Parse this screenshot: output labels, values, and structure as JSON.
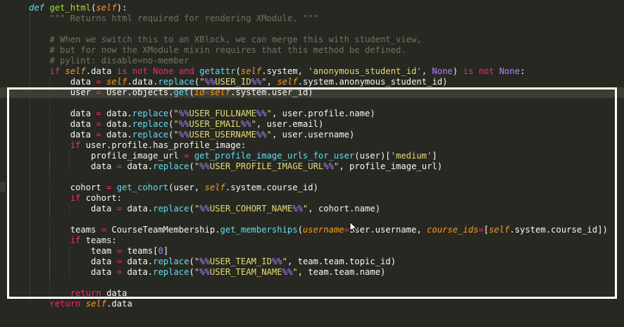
{
  "editor": {
    "theme_colors": {
      "background": "#272822",
      "default": "#f8f8f2",
      "keyword": "#f92672",
      "def": "#66d9ef",
      "function": "#a6e22e",
      "string": "#e6db74",
      "comment": "#75715e",
      "self": "#fd971f",
      "number": "#ae81ff",
      "format": "#ae81ff",
      "param": "#fd971f"
    },
    "lines": [
      {
        "tokens": [
          {
            "t": "def ",
            "c": "def",
            "i": true
          },
          {
            "t": "get_html",
            "c": "function"
          },
          {
            "t": "(",
            "c": "default"
          },
          {
            "t": "self",
            "c": "self",
            "i": true
          },
          {
            "t": "):",
            "c": "default"
          }
        ]
      },
      {
        "tokens": [
          {
            "t": "    ",
            "c": "default"
          },
          {
            "t": "\"\"\" Returns html required for rendering XModule. \"\"\"",
            "c": "comment"
          }
        ]
      },
      {
        "tokens": [
          {
            "t": "",
            "c": "default"
          }
        ]
      },
      {
        "tokens": [
          {
            "t": "    ",
            "c": "default"
          },
          {
            "t": "# When we switch this to an XBlock, we can merge this with student_view,",
            "c": "comment"
          }
        ]
      },
      {
        "tokens": [
          {
            "t": "    ",
            "c": "default"
          },
          {
            "t": "# but for now the XModule mixin requires that this method be defined.",
            "c": "comment"
          }
        ]
      },
      {
        "tokens": [
          {
            "t": "    ",
            "c": "default"
          },
          {
            "t": "# pylint: disable=no-member",
            "c": "comment"
          }
        ]
      },
      {
        "tokens": [
          {
            "t": "    ",
            "c": "default"
          },
          {
            "t": "if ",
            "c": "keyword"
          },
          {
            "t": "self",
            "c": "self",
            "i": true
          },
          {
            "t": ".data ",
            "c": "default"
          },
          {
            "t": "is not None and ",
            "c": "keyword"
          },
          {
            "t": "getattr",
            "c": "def"
          },
          {
            "t": "(",
            "c": "default"
          },
          {
            "t": "self",
            "c": "self",
            "i": true
          },
          {
            "t": ".system, ",
            "c": "default"
          },
          {
            "t": "'anonymous_student_id'",
            "c": "string"
          },
          {
            "t": ", ",
            "c": "default"
          },
          {
            "t": "None",
            "c": "number"
          },
          {
            "t": ") ",
            "c": "default"
          },
          {
            "t": "is not ",
            "c": "keyword"
          },
          {
            "t": "None",
            "c": "number"
          },
          {
            "t": ":",
            "c": "default"
          }
        ]
      },
      {
        "tokens": [
          {
            "t": "        data ",
            "c": "default"
          },
          {
            "t": "= ",
            "c": "keyword"
          },
          {
            "t": "self",
            "c": "self",
            "i": true
          },
          {
            "t": ".data.",
            "c": "default"
          },
          {
            "t": "replace",
            "c": "def"
          },
          {
            "t": "(",
            "c": "default"
          },
          {
            "t": "\"",
            "c": "string"
          },
          {
            "t": "%%",
            "c": "format"
          },
          {
            "t": "USER_ID",
            "c": "string"
          },
          {
            "t": "%%",
            "c": "format"
          },
          {
            "t": "\"",
            "c": "string"
          },
          {
            "t": ", ",
            "c": "default"
          },
          {
            "t": "self",
            "c": "self",
            "i": true
          },
          {
            "t": ".system.anonymous_student_id)",
            "c": "default"
          }
        ]
      },
      {
        "hl": true,
        "tokens": [
          {
            "t": "        user ",
            "c": "default"
          },
          {
            "t": "= ",
            "c": "keyword"
          },
          {
            "t": "User.objects.",
            "c": "default"
          },
          {
            "t": "get",
            "c": "def"
          },
          {
            "t": "(",
            "c": "default"
          },
          {
            "t": "id",
            "c": "param",
            "i": true
          },
          {
            "t": "=",
            "c": "keyword"
          },
          {
            "t": "self",
            "c": "self",
            "i": true
          },
          {
            "t": ".system.user_id)",
            "c": "default"
          }
        ]
      },
      {
        "tokens": [
          {
            "t": "",
            "c": "default"
          }
        ]
      },
      {
        "tokens": [
          {
            "t": "        data ",
            "c": "default"
          },
          {
            "t": "= ",
            "c": "keyword"
          },
          {
            "t": "data.",
            "c": "default"
          },
          {
            "t": "replace",
            "c": "def"
          },
          {
            "t": "(",
            "c": "default"
          },
          {
            "t": "\"",
            "c": "string"
          },
          {
            "t": "%%",
            "c": "format"
          },
          {
            "t": "USER_FULLNAME",
            "c": "string"
          },
          {
            "t": "%%",
            "c": "format"
          },
          {
            "t": "\"",
            "c": "string"
          },
          {
            "t": ", user.profile.name)",
            "c": "default"
          }
        ]
      },
      {
        "tokens": [
          {
            "t": "        data ",
            "c": "default"
          },
          {
            "t": "= ",
            "c": "keyword"
          },
          {
            "t": "data.",
            "c": "default"
          },
          {
            "t": "replace",
            "c": "def"
          },
          {
            "t": "(",
            "c": "default"
          },
          {
            "t": "\"",
            "c": "string"
          },
          {
            "t": "%%",
            "c": "format"
          },
          {
            "t": "USER_EMAIL",
            "c": "string"
          },
          {
            "t": "%%",
            "c": "format"
          },
          {
            "t": "\"",
            "c": "string"
          },
          {
            "t": ", user.email)",
            "c": "default"
          }
        ]
      },
      {
        "tokens": [
          {
            "t": "        data ",
            "c": "default"
          },
          {
            "t": "= ",
            "c": "keyword"
          },
          {
            "t": "data.",
            "c": "default"
          },
          {
            "t": "replace",
            "c": "def"
          },
          {
            "t": "(",
            "c": "default"
          },
          {
            "t": "\"",
            "c": "string"
          },
          {
            "t": "%%",
            "c": "format"
          },
          {
            "t": "USER_USERNAME",
            "c": "string"
          },
          {
            "t": "%%",
            "c": "format"
          },
          {
            "t": "\"",
            "c": "string"
          },
          {
            "t": ", user.username)",
            "c": "default"
          }
        ]
      },
      {
        "tokens": [
          {
            "t": "        ",
            "c": "default"
          },
          {
            "t": "if ",
            "c": "keyword"
          },
          {
            "t": "user.profile.has_profile_image:",
            "c": "default"
          }
        ]
      },
      {
        "tokens": [
          {
            "t": "            profile_image_url ",
            "c": "default"
          },
          {
            "t": "= ",
            "c": "keyword"
          },
          {
            "t": "get_profile_image_urls_for_user",
            "c": "def"
          },
          {
            "t": "(user)[",
            "c": "default"
          },
          {
            "t": "'medium'",
            "c": "string"
          },
          {
            "t": "]",
            "c": "default"
          }
        ]
      },
      {
        "tokens": [
          {
            "t": "            data ",
            "c": "default"
          },
          {
            "t": "= ",
            "c": "keyword"
          },
          {
            "t": "data.",
            "c": "default"
          },
          {
            "t": "replace",
            "c": "def"
          },
          {
            "t": "(",
            "c": "default"
          },
          {
            "t": "\"",
            "c": "string"
          },
          {
            "t": "%%",
            "c": "format"
          },
          {
            "t": "USER_PROFILE_IMAGE_URL",
            "c": "string"
          },
          {
            "t": "%%",
            "c": "format"
          },
          {
            "t": "\"",
            "c": "string"
          },
          {
            "t": ", profile_image_url)",
            "c": "default"
          }
        ]
      },
      {
        "tokens": [
          {
            "t": "",
            "c": "default"
          }
        ]
      },
      {
        "tokens": [
          {
            "t": "        cohort ",
            "c": "default"
          },
          {
            "t": "= ",
            "c": "keyword"
          },
          {
            "t": "get_cohort",
            "c": "def"
          },
          {
            "t": "(user, ",
            "c": "default"
          },
          {
            "t": "self",
            "c": "self",
            "i": true
          },
          {
            "t": ".system.course_id)",
            "c": "default"
          }
        ]
      },
      {
        "tokens": [
          {
            "t": "        ",
            "c": "default"
          },
          {
            "t": "if ",
            "c": "keyword"
          },
          {
            "t": "cohort:",
            "c": "default"
          }
        ]
      },
      {
        "tokens": [
          {
            "t": "            data ",
            "c": "default"
          },
          {
            "t": "= ",
            "c": "keyword"
          },
          {
            "t": "data.",
            "c": "default"
          },
          {
            "t": "replace",
            "c": "def"
          },
          {
            "t": "(",
            "c": "default"
          },
          {
            "t": "\"",
            "c": "string"
          },
          {
            "t": "%%",
            "c": "format"
          },
          {
            "t": "USER_COHORT_NAME",
            "c": "string"
          },
          {
            "t": "%%",
            "c": "format"
          },
          {
            "t": "\"",
            "c": "string"
          },
          {
            "t": ", cohort.name)",
            "c": "default"
          }
        ]
      },
      {
        "tokens": [
          {
            "t": "",
            "c": "default"
          }
        ]
      },
      {
        "tokens": [
          {
            "t": "        teams ",
            "c": "default"
          },
          {
            "t": "= ",
            "c": "keyword"
          },
          {
            "t": "CourseTeamMembership.",
            "c": "default"
          },
          {
            "t": "get_memberships",
            "c": "def"
          },
          {
            "t": "(",
            "c": "default"
          },
          {
            "t": "username",
            "c": "param",
            "i": true
          },
          {
            "t": "=",
            "c": "keyword"
          },
          {
            "t": "user.username, ",
            "c": "default"
          },
          {
            "t": "course_ids",
            "c": "param",
            "i": true
          },
          {
            "t": "=",
            "c": "keyword"
          },
          {
            "t": "[",
            "c": "default"
          },
          {
            "t": "self",
            "c": "self",
            "i": true
          },
          {
            "t": ".system.course_id])",
            "c": "default"
          }
        ]
      },
      {
        "tokens": [
          {
            "t": "        ",
            "c": "default"
          },
          {
            "t": "if ",
            "c": "keyword"
          },
          {
            "t": "teams:",
            "c": "default"
          }
        ]
      },
      {
        "tokens": [
          {
            "t": "            team ",
            "c": "default"
          },
          {
            "t": "= ",
            "c": "keyword"
          },
          {
            "t": "teams[",
            "c": "default"
          },
          {
            "t": "0",
            "c": "number"
          },
          {
            "t": "]",
            "c": "default"
          }
        ]
      },
      {
        "tokens": [
          {
            "t": "            data ",
            "c": "default"
          },
          {
            "t": "= ",
            "c": "keyword"
          },
          {
            "t": "data.",
            "c": "default"
          },
          {
            "t": "replace",
            "c": "def"
          },
          {
            "t": "(",
            "c": "default"
          },
          {
            "t": "\"",
            "c": "string"
          },
          {
            "t": "%%",
            "c": "format"
          },
          {
            "t": "USER_TEAM_ID",
            "c": "string"
          },
          {
            "t": "%%",
            "c": "format"
          },
          {
            "t": "\"",
            "c": "string"
          },
          {
            "t": ", team.team.topic_id)",
            "c": "default"
          }
        ]
      },
      {
        "tokens": [
          {
            "t": "            data ",
            "c": "default"
          },
          {
            "t": "= ",
            "c": "keyword"
          },
          {
            "t": "data.",
            "c": "default"
          },
          {
            "t": "replace",
            "c": "def"
          },
          {
            "t": "(",
            "c": "default"
          },
          {
            "t": "\"",
            "c": "string"
          },
          {
            "t": "%%",
            "c": "format"
          },
          {
            "t": "USER_TEAM_NAME",
            "c": "string"
          },
          {
            "t": "%%",
            "c": "format"
          },
          {
            "t": "\"",
            "c": "string"
          },
          {
            "t": ", team.team.name)",
            "c": "default"
          }
        ]
      },
      {
        "tokens": [
          {
            "t": "",
            "c": "default"
          }
        ]
      },
      {
        "tokens": [
          {
            "t": "        ",
            "c": "default"
          },
          {
            "t": "return ",
            "c": "keyword"
          },
          {
            "t": "data",
            "c": "default"
          }
        ]
      },
      {
        "tokens": [
          {
            "t": "    ",
            "c": "default"
          },
          {
            "t": "return ",
            "c": "keyword"
          },
          {
            "t": "self",
            "c": "self",
            "i": true
          },
          {
            "t": ".data",
            "c": "default"
          }
        ]
      }
    ]
  }
}
